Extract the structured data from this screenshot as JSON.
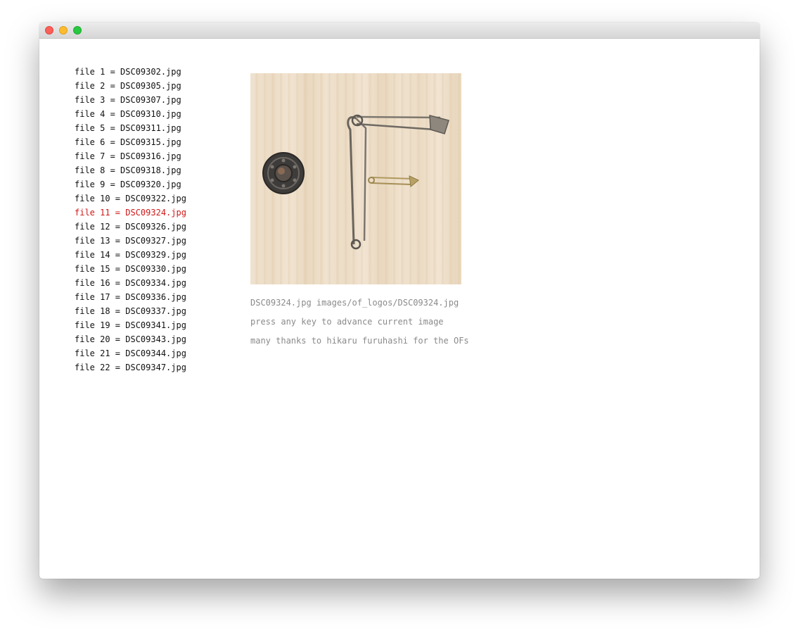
{
  "window": {
    "controls": [
      "close",
      "minimize",
      "zoom"
    ]
  },
  "files": [
    "file 1 = DSC09302.jpg",
    "file 2 = DSC09305.jpg",
    "file 3 = DSC09307.jpg",
    "file 4 = DSC09310.jpg",
    "file 5 = DSC09311.jpg",
    "file 6 = DSC09315.jpg",
    "file 7 = DSC09316.jpg",
    "file 8 = DSC09318.jpg",
    "file 9 = DSC09320.jpg",
    "file 10 = DSC09322.jpg",
    "file 11 = DSC09324.jpg",
    "file 12 = DSC09326.jpg",
    "file 13 = DSC09327.jpg",
    "file 14 = DSC09329.jpg",
    "file 15 = DSC09330.jpg",
    "file 16 = DSC09334.jpg",
    "file 17 = DSC09336.jpg",
    "file 18 = DSC09337.jpg",
    "file 19 = DSC09341.jpg",
    "file 20 = DSC09343.jpg",
    "file 21 = DSC09344.jpg",
    "file 22 = DSC09347.jpg"
  ],
  "current_index": 10,
  "captions": {
    "path_line": "DSC09324.jpg images/of_logos/DSC09324.jpg",
    "instruction": "press any key to advance current image",
    "thanks": "many thanks to hikaru furuhashi for the OFs"
  },
  "colors": {
    "list_text": "#111111",
    "current_item": "#d01818",
    "caption_text": "#8a8a8a"
  }
}
